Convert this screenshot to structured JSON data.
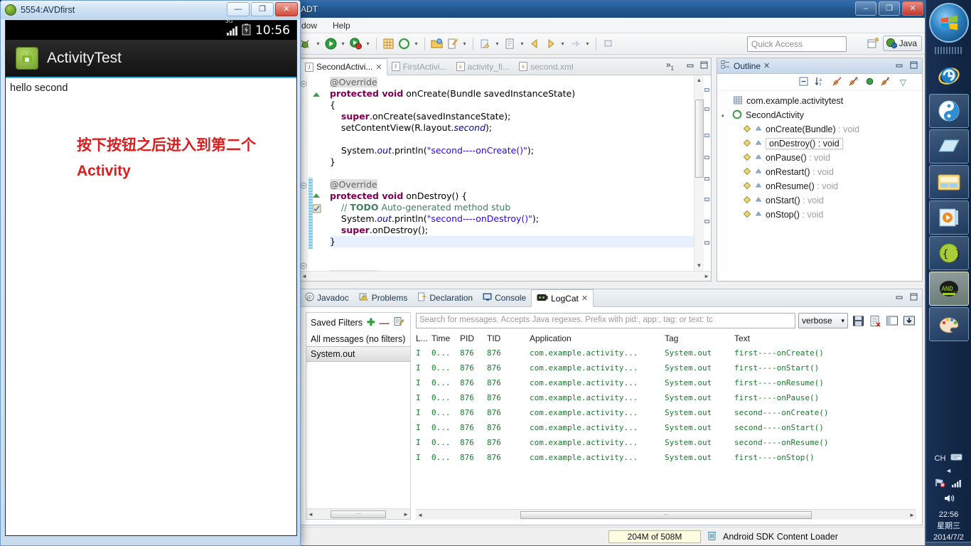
{
  "eclipse": {
    "title": "ADT",
    "window_buttons": {
      "minimize": "–",
      "maximize": "❐",
      "close": "✕"
    },
    "menu": [
      "dow",
      "Help"
    ],
    "quick_access": {
      "placeholder": "Quick Access"
    },
    "perspective": {
      "label": "Java"
    }
  },
  "editor": {
    "tabs": [
      {
        "label": "SecondActivi...",
        "kind": "java",
        "active": true,
        "close": "✕"
      },
      {
        "label": "FirstActivi...",
        "kind": "java",
        "active": false,
        "close": ""
      },
      {
        "label": "activity_fi...",
        "kind": "xml",
        "active": false,
        "close": ""
      },
      {
        "label": "second.xml",
        "kind": "xml",
        "active": false,
        "close": ""
      }
    ],
    "more_tabs": "»",
    "more_tabs_count": "1",
    "minimize": "—",
    "maximize": "❐",
    "code_lines": [
      "    @Override",
      "    protected void onCreate(Bundle savedInstanceState)",
      "    {",
      "        super.onCreate(savedInstanceState);",
      "        setContentView(R.layout.second);",
      "",
      "        System.out.println(\"second----onCreate()\");",
      "    }",
      "",
      "    @Override",
      "    protected void onDestroy() {",
      "        // TODO Auto-generated method stub",
      "        System.out.println(\"second----onDestroy()\");",
      "        super.onDestroy();",
      "    }",
      "",
      "    @Override"
    ]
  },
  "outline": {
    "title": "Outline",
    "close": "✕",
    "minimize": "—",
    "maximize": "❐",
    "toolbar_icons": [
      "collapse-all-icon",
      "sort-icon",
      "hide-fields-icon",
      "hide-static-icon",
      "hide-nonpublic-icon",
      "hide-local-icon",
      "view-menu-icon"
    ],
    "items": [
      {
        "label": "com.example.activitytest",
        "ret": "",
        "kind": "package",
        "indent": 1,
        "selected": false,
        "twisty": ""
      },
      {
        "label": "SecondActivity",
        "ret": "",
        "kind": "class",
        "indent": 0,
        "selected": false,
        "twisty": "▴"
      },
      {
        "label": "onCreate(Bundle)",
        "ret": " : void",
        "kind": "method",
        "indent": 2,
        "selected": false,
        "twisty": ""
      },
      {
        "label": "onDestroy()",
        "ret": " : void",
        "kind": "method",
        "indent": 2,
        "selected": true,
        "twisty": ""
      },
      {
        "label": "onPause()",
        "ret": " : void",
        "kind": "method",
        "indent": 2,
        "selected": false,
        "twisty": ""
      },
      {
        "label": "onRestart()",
        "ret": " : void",
        "kind": "method",
        "indent": 2,
        "selected": false,
        "twisty": ""
      },
      {
        "label": "onResume()",
        "ret": " : void",
        "kind": "method",
        "indent": 2,
        "selected": false,
        "twisty": ""
      },
      {
        "label": "onStart()",
        "ret": " : void",
        "kind": "method",
        "indent": 2,
        "selected": false,
        "twisty": ""
      },
      {
        "label": "onStop()",
        "ret": " : void",
        "kind": "method",
        "indent": 2,
        "selected": false,
        "twisty": ""
      }
    ]
  },
  "bottom_panel": {
    "tabs": [
      {
        "label": "Javadoc",
        "icon": "javadoc-icon",
        "active": false,
        "close": ""
      },
      {
        "label": "Problems",
        "icon": "problems-icon",
        "active": false,
        "close": ""
      },
      {
        "label": "Declaration",
        "icon": "declaration-icon",
        "active": false,
        "close": ""
      },
      {
        "label": "Console",
        "icon": "console-icon",
        "active": false,
        "close": ""
      },
      {
        "label": "LogCat",
        "icon": "logcat-icon",
        "active": true,
        "close": "✕"
      }
    ],
    "minimize": "—",
    "maximize": "❐",
    "filters": {
      "title": "Saved Filters",
      "add": "✚",
      "remove": "—",
      "edit": "edit-filter-icon",
      "items": [
        {
          "label": "All messages (no filters)",
          "selected": false
        },
        {
          "label": "System.out",
          "selected": true
        }
      ]
    },
    "logcat": {
      "search_placeholder": "Search for messages. Accepts Java regexes. Prefix with pid:, app:, tag: or text: tc",
      "level": "verbose",
      "level_caret": "▾",
      "buttons": [
        "save-log-icon",
        "clear-log-icon",
        "display-view-icon",
        "scroll-lock-icon"
      ],
      "columns": [
        "L...",
        "Time",
        "PID",
        "TID",
        "Application",
        "Tag",
        "Text"
      ],
      "rows": [
        {
          "level": "I",
          "time": "0...",
          "pid": "876",
          "tid": "876",
          "app": "com.example.activity...",
          "tag": "System.out",
          "text": "first----onCreate()"
        },
        {
          "level": "I",
          "time": "0...",
          "pid": "876",
          "tid": "876",
          "app": "com.example.activity...",
          "tag": "System.out",
          "text": "first----onStart()"
        },
        {
          "level": "I",
          "time": "0...",
          "pid": "876",
          "tid": "876",
          "app": "com.example.activity...",
          "tag": "System.out",
          "text": "first----onResume()"
        },
        {
          "level": "I",
          "time": "0...",
          "pid": "876",
          "tid": "876",
          "app": "com.example.activity...",
          "tag": "System.out",
          "text": "first----onPause()"
        },
        {
          "level": "I",
          "time": "0...",
          "pid": "876",
          "tid": "876",
          "app": "com.example.activity...",
          "tag": "System.out",
          "text": "second----onCreate()"
        },
        {
          "level": "I",
          "time": "0...",
          "pid": "876",
          "tid": "876",
          "app": "com.example.activity...",
          "tag": "System.out",
          "text": "second----onStart()"
        },
        {
          "level": "I",
          "time": "0...",
          "pid": "876",
          "tid": "876",
          "app": "com.example.activity...",
          "tag": "System.out",
          "text": "second----onResume()"
        },
        {
          "level": "I",
          "time": "0...",
          "pid": "876",
          "tid": "876",
          "app": "com.example.activity...",
          "tag": "System.out",
          "text": "first----onStop()"
        }
      ]
    }
  },
  "status_bar": {
    "heap": "204M of 508M",
    "trash_icon": "trash-icon",
    "task": "Android SDK Content Loader"
  },
  "emulator": {
    "window_title": "5554:AVDfirst",
    "window_buttons": {
      "minimize": "—",
      "maximize": "❐",
      "close": "✕"
    },
    "status": {
      "network": "3G",
      "battery": "battery-icon",
      "clock": "10:56"
    },
    "action_bar": {
      "app_title": "ActivityTest"
    },
    "content": {
      "hello": "hello second",
      "red_text": "按下按钮之后进入到第二个Activity"
    }
  },
  "taskbar": {
    "start": "windows-start-icon",
    "items": [
      {
        "icon": "internet-explorer-icon",
        "boxed": false,
        "active": false
      },
      {
        "icon": "sogou-browser-icon",
        "boxed": true,
        "active": false
      },
      {
        "icon": "windows-explorer-icon",
        "boxed": true,
        "active": false
      },
      {
        "icon": "file-manager-icon",
        "boxed": true,
        "active": false
      },
      {
        "icon": "media-player-icon",
        "boxed": true,
        "active": false
      },
      {
        "icon": "json-viewer-icon",
        "boxed": true,
        "active": false
      },
      {
        "icon": "android-emulator-icon",
        "boxed": true,
        "active": true
      },
      {
        "icon": "paint-icon",
        "boxed": true,
        "active": false
      }
    ],
    "tray": {
      "ime": "CH",
      "keyboard_icon": "keyboard-icon",
      "hidden_icon": "show-hidden-icons-icon",
      "network_icon": "network-icon",
      "signal_icon": "signal-icon",
      "volume_icon": "volume-icon",
      "time": "22:56",
      "weekday": "星期三",
      "date": "2014/7/2"
    }
  }
}
